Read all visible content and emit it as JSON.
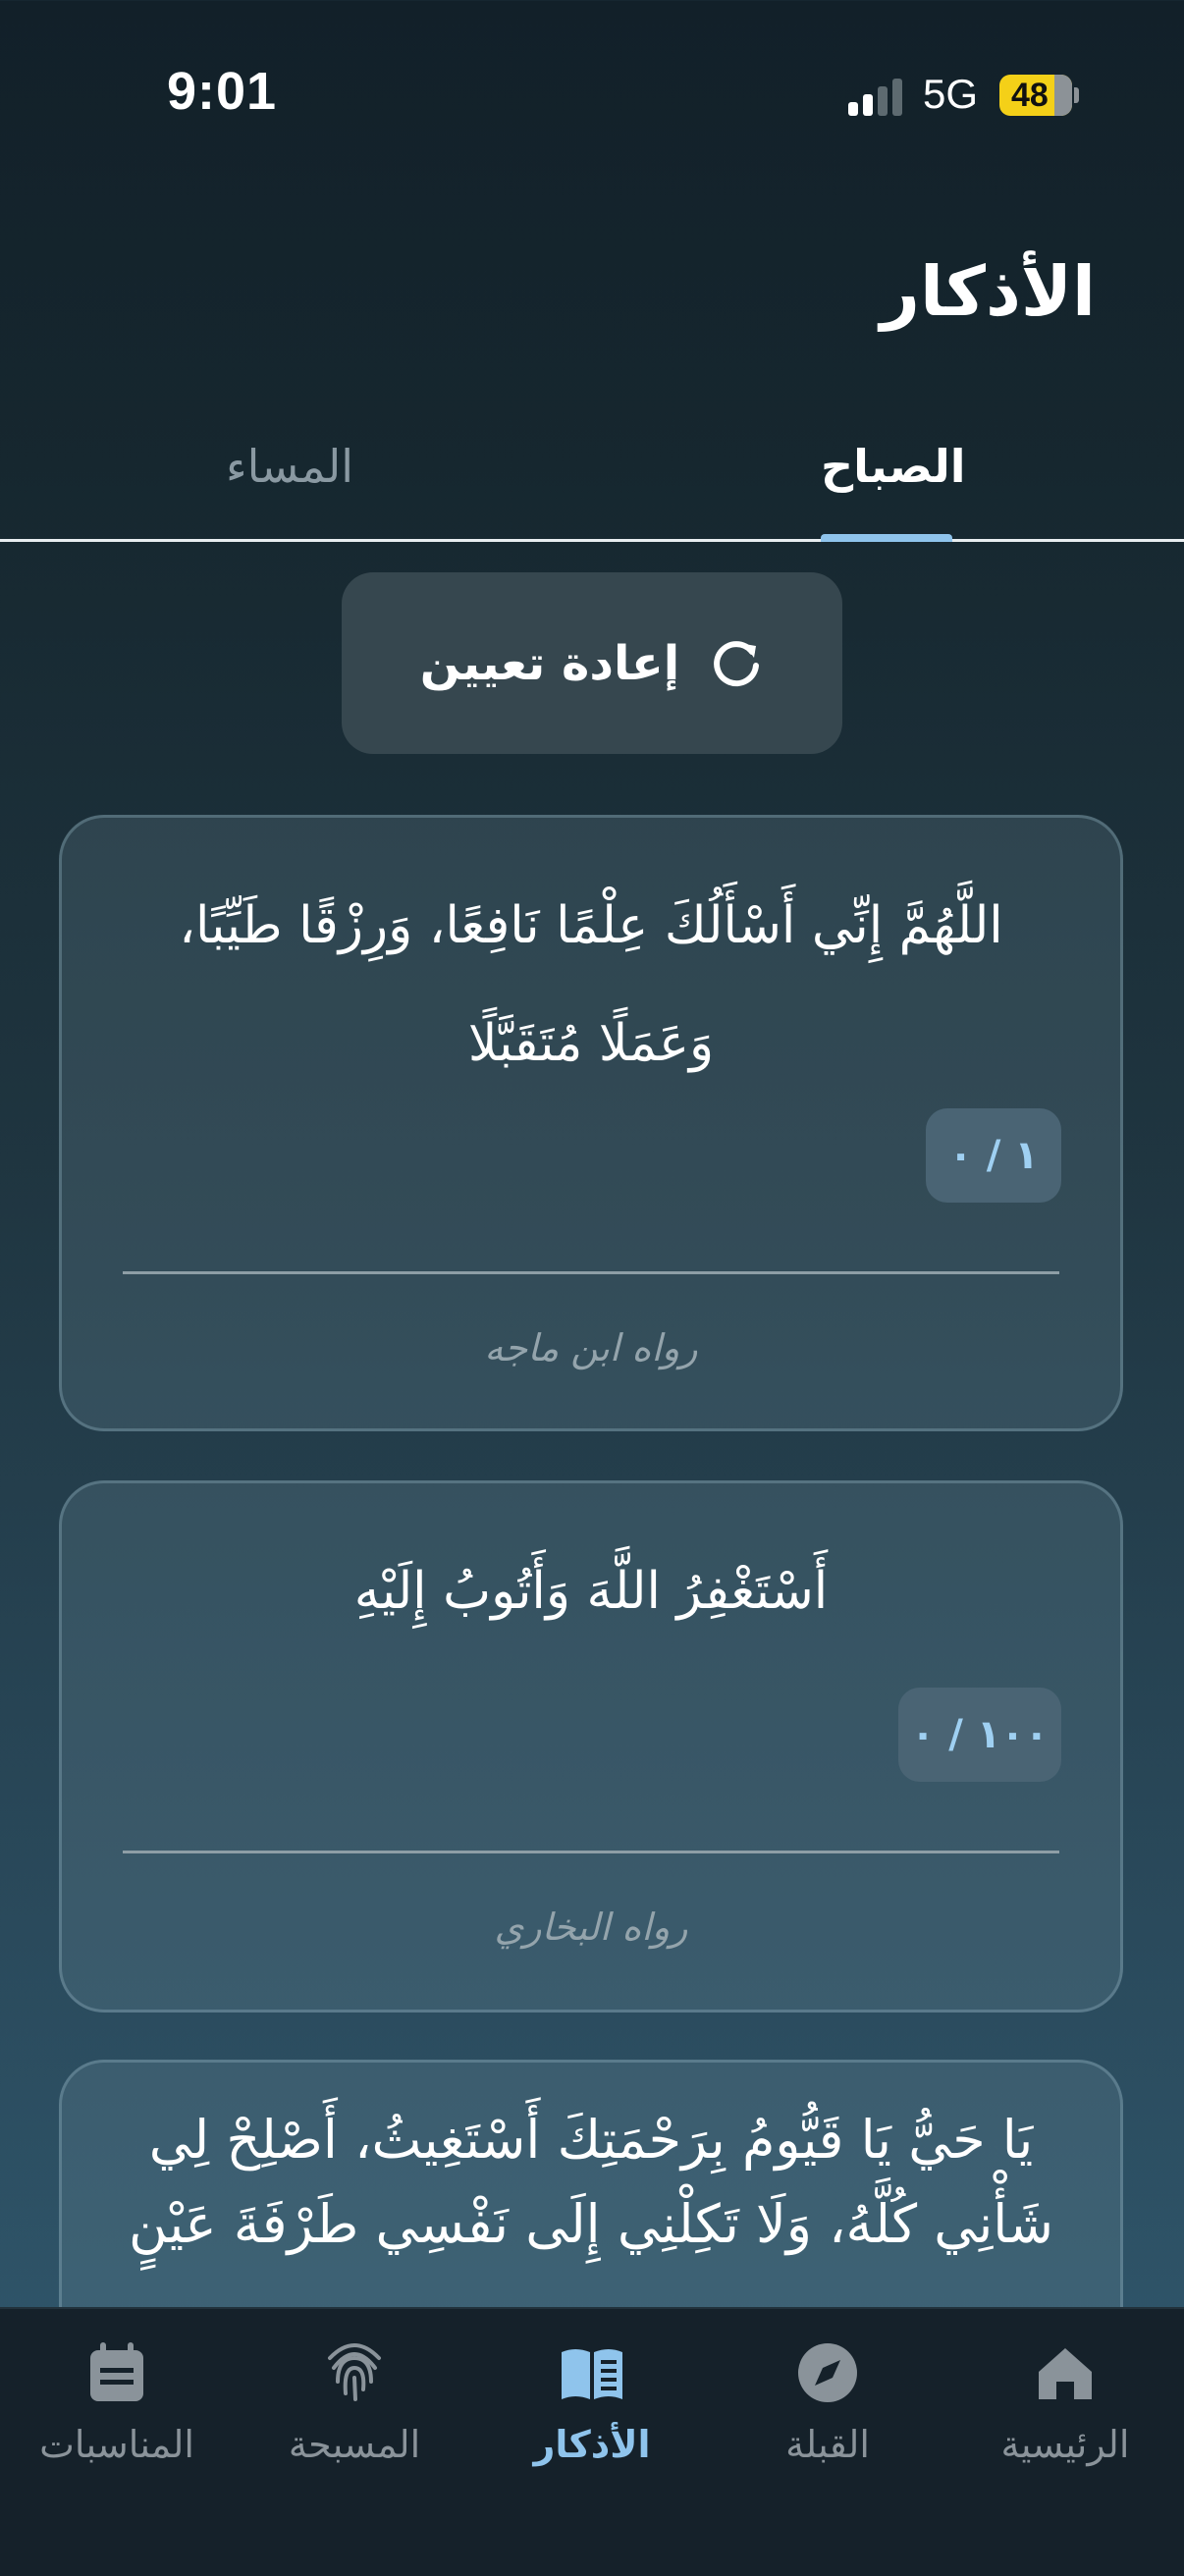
{
  "status_bar": {
    "time": "9:01",
    "network": "5G",
    "battery": "48"
  },
  "header": {
    "title": "الأذكار"
  },
  "tabs": [
    {
      "label": "الصباح",
      "active": true
    },
    {
      "label": "المساء",
      "active": false
    }
  ],
  "reset": {
    "label": "إعادة تعيين",
    "icon": "refresh-icon"
  },
  "cards": [
    {
      "text": "اللَّهُمَّ إِنِّي أَسْأَلُكَ عِلْمًا نَافِعًا، وَرِزْقًا طَيِّبًا، وَعَمَلًا مُتَقَبَّلًا",
      "counter": "١ / ٠",
      "source": "رواه ابن ماجه"
    },
    {
      "text": "أَسْتَغْفِرُ اللَّهَ وَأَتُوبُ إِلَيْهِ",
      "counter": "١٠٠ / ٠",
      "source": "رواه البخاري"
    },
    {
      "text": "يَا حَيُّ يَا قَيُّومُ بِرَحْمَتِكَ أَسْتَغِيثُ، أَصْلِحْ لِي شَأْنِي كُلَّهُ، وَلَا تَكِلْنِي إِلَى نَفْسِي طَرْفَةَ عَيْنٍ"
    }
  ],
  "bottom_nav": [
    {
      "label": "الرئيسية",
      "icon": "home-icon",
      "active": false
    },
    {
      "label": "القبلة",
      "icon": "compass-icon",
      "active": false
    },
    {
      "label": "الأذكار",
      "icon": "book-icon",
      "active": true
    },
    {
      "label": "المسبحة",
      "icon": "fingerprint-icon",
      "active": false
    },
    {
      "label": "المناسبات",
      "icon": "calendar-icon",
      "active": false
    }
  ],
  "colors": {
    "accent": "#8fc4ec",
    "battery": "#f4d018",
    "inactive": "#8a939a"
  }
}
